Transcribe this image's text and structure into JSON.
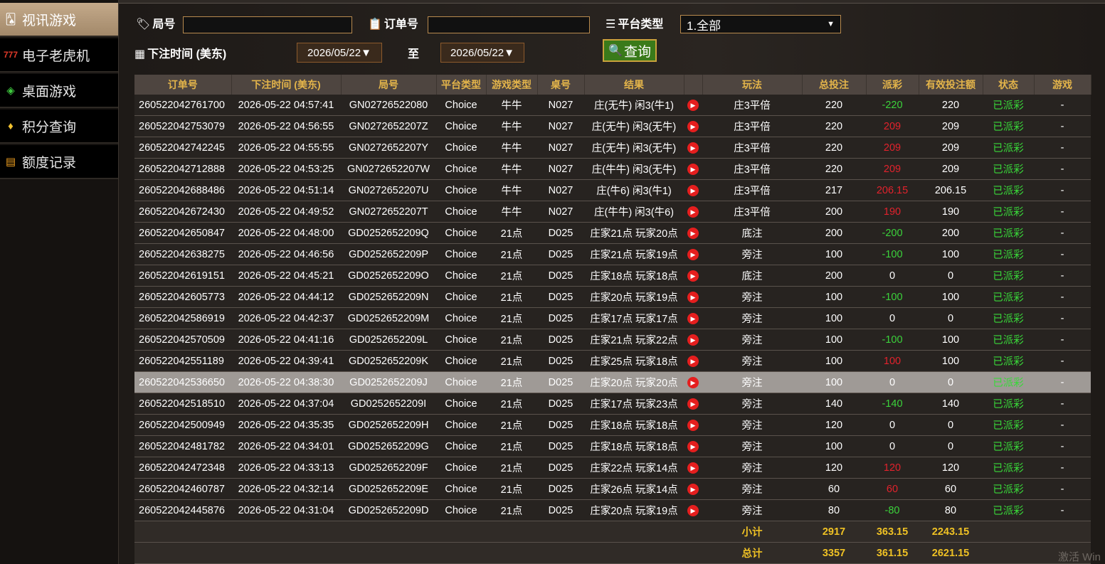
{
  "sidebar": {
    "items": [
      {
        "label": "视讯游戏",
        "icon": "cards-icon",
        "active": true
      },
      {
        "label": "电子老虎机",
        "icon": "slot-777-icon",
        "active": false
      },
      {
        "label": "桌面游戏",
        "icon": "chip-icon",
        "active": false
      },
      {
        "label": "积分查询",
        "icon": "diamond-icon",
        "active": false
      },
      {
        "label": "额度记录",
        "icon": "document-icon",
        "active": false
      }
    ]
  },
  "filters": {
    "round_label": "局号",
    "round_value": "",
    "order_label": "订单号",
    "order_value": "",
    "platform_label": "平台类型",
    "platform_value": "1.全部",
    "time_label": "下注时间 (美东)",
    "date_from": "2026/05/22▼",
    "to_label": "至",
    "date_to": "2026/05/22▼",
    "query_button": "查询"
  },
  "table": {
    "headers": [
      "订单号",
      "下注时间 (美东)",
      "局号",
      "平台类型",
      "游戏类型",
      "桌号",
      "结果",
      "",
      "玩法",
      "总投注",
      "派彩",
      "有效投注额",
      "状态",
      "游戏"
    ],
    "rows": [
      [
        "260522042761700",
        "2026-05-22 04:57:41",
        "GN02726522080",
        "Choice",
        "牛牛",
        "N027",
        "庄(无牛) 闲3(牛1)",
        "庄3平倍",
        "220",
        "-220",
        "220",
        "已派彩",
        "-"
      ],
      [
        "260522042753079",
        "2026-05-22 04:56:55",
        "GN0272652207Z",
        "Choice",
        "牛牛",
        "N027",
        "庄(无牛) 闲3(无牛)",
        "庄3平倍",
        "220",
        "209",
        "209",
        "已派彩",
        "-"
      ],
      [
        "260522042742245",
        "2026-05-22 04:55:55",
        "GN0272652207Y",
        "Choice",
        "牛牛",
        "N027",
        "庄(无牛) 闲3(无牛)",
        "庄3平倍",
        "220",
        "209",
        "209",
        "已派彩",
        "-"
      ],
      [
        "260522042712888",
        "2026-05-22 04:53:25",
        "GN0272652207W",
        "Choice",
        "牛牛",
        "N027",
        "庄(牛牛) 闲3(无牛)",
        "庄3平倍",
        "220",
        "209",
        "209",
        "已派彩",
        "-"
      ],
      [
        "260522042688486",
        "2026-05-22 04:51:14",
        "GN0272652207U",
        "Choice",
        "牛牛",
        "N027",
        "庄(牛6) 闲3(牛1)",
        "庄3平倍",
        "217",
        "206.15",
        "206.15",
        "已派彩",
        "-"
      ],
      [
        "260522042672430",
        "2026-05-22 04:49:52",
        "GN0272652207T",
        "Choice",
        "牛牛",
        "N027",
        "庄(牛牛) 闲3(牛6)",
        "庄3平倍",
        "200",
        "190",
        "190",
        "已派彩",
        "-"
      ],
      [
        "260522042650847",
        "2026-05-22 04:48:00",
        "GD0252652209Q",
        "Choice",
        "21点",
        "D025",
        "庄家21点 玩家20点",
        "底注",
        "200",
        "-200",
        "200",
        "已派彩",
        "-"
      ],
      [
        "260522042638275",
        "2026-05-22 04:46:56",
        "GD0252652209P",
        "Choice",
        "21点",
        "D025",
        "庄家21点 玩家19点",
        "旁注",
        "100",
        "-100",
        "100",
        "已派彩",
        "-"
      ],
      [
        "260522042619151",
        "2026-05-22 04:45:21",
        "GD0252652209O",
        "Choice",
        "21点",
        "D025",
        "庄家18点 玩家18点",
        "底注",
        "200",
        "0",
        "0",
        "已派彩",
        "-"
      ],
      [
        "260522042605773",
        "2026-05-22 04:44:12",
        "GD0252652209N",
        "Choice",
        "21点",
        "D025",
        "庄家20点 玩家19点",
        "旁注",
        "100",
        "-100",
        "100",
        "已派彩",
        "-"
      ],
      [
        "260522042586919",
        "2026-05-22 04:42:37",
        "GD0252652209M",
        "Choice",
        "21点",
        "D025",
        "庄家17点 玩家17点",
        "旁注",
        "100",
        "0",
        "0",
        "已派彩",
        "-"
      ],
      [
        "260522042570509",
        "2026-05-22 04:41:16",
        "GD0252652209L",
        "Choice",
        "21点",
        "D025",
        "庄家21点 玩家22点",
        "旁注",
        "100",
        "-100",
        "100",
        "已派彩",
        "-"
      ],
      [
        "260522042551189",
        "2026-05-22 04:39:41",
        "GD0252652209K",
        "Choice",
        "21点",
        "D025",
        "庄家25点 玩家18点",
        "旁注",
        "100",
        "100",
        "100",
        "已派彩",
        "-"
      ],
      [
        "260522042536650",
        "2026-05-22 04:38:30",
        "GD0252652209J",
        "Choice",
        "21点",
        "D025",
        "庄家20点 玩家20点",
        "旁注",
        "100",
        "0",
        "0",
        "已派彩",
        "-"
      ],
      [
        "260522042518510",
        "2026-05-22 04:37:04",
        "GD0252652209I",
        "Choice",
        "21点",
        "D025",
        "庄家17点 玩家23点",
        "旁注",
        "140",
        "-140",
        "140",
        "已派彩",
        "-"
      ],
      [
        "260522042500949",
        "2026-05-22 04:35:35",
        "GD0252652209H",
        "Choice",
        "21点",
        "D025",
        "庄家18点 玩家18点",
        "旁注",
        "120",
        "0",
        "0",
        "已派彩",
        "-"
      ],
      [
        "260522042481782",
        "2026-05-22 04:34:01",
        "GD0252652209G",
        "Choice",
        "21点",
        "D025",
        "庄家18点 玩家18点",
        "旁注",
        "100",
        "0",
        "0",
        "已派彩",
        "-"
      ],
      [
        "260522042472348",
        "2026-05-22 04:33:13",
        "GD0252652209F",
        "Choice",
        "21点",
        "D025",
        "庄家22点 玩家14点",
        "旁注",
        "120",
        "120",
        "120",
        "已派彩",
        "-"
      ],
      [
        "260522042460787",
        "2026-05-22 04:32:14",
        "GD0252652209E",
        "Choice",
        "21点",
        "D025",
        "庄家26点 玩家14点",
        "旁注",
        "60",
        "60",
        "60",
        "已派彩",
        "-"
      ],
      [
        "260522042445876",
        "2026-05-22 04:31:04",
        "GD0252652209D",
        "Choice",
        "21点",
        "D025",
        "庄家20点 玩家19点",
        "旁注",
        "80",
        "-80",
        "80",
        "已派彩",
        "-"
      ]
    ],
    "selected_row": 13,
    "subtotal": {
      "label": "小计",
      "bet": "2917",
      "payout": "363.15",
      "valid": "2243.15"
    },
    "total": {
      "label": "总计",
      "bet": "3357",
      "payout": "361.15",
      "valid": "2621.15"
    }
  },
  "watermark": "激活 Win",
  "colors": {
    "accent": "#e3b44a",
    "negative": "#3bd23b",
    "positive": "#e2222c",
    "status": "#39d839",
    "border": "#b88a4e"
  }
}
